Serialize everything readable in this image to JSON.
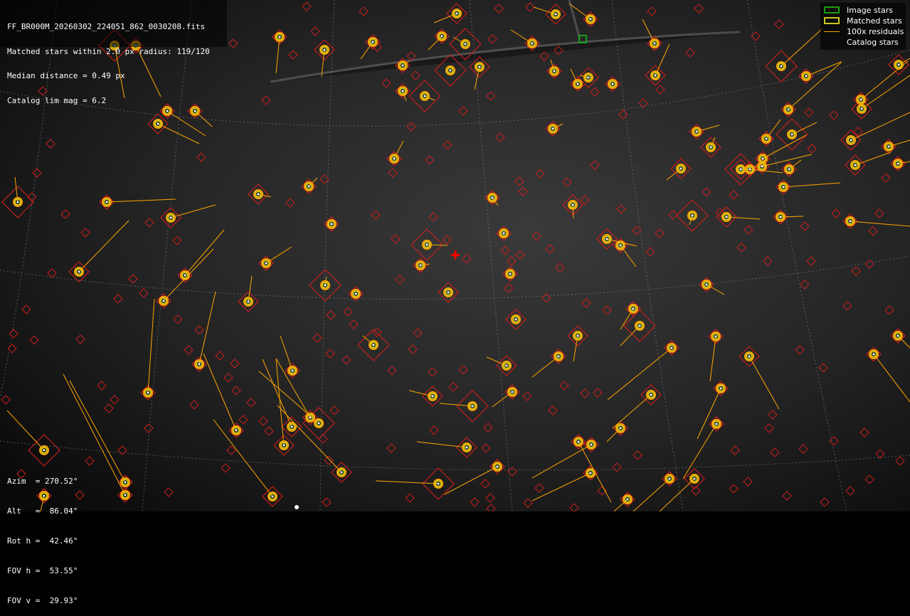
{
  "info": {
    "filename": "FF_BR000M_20260302_224051_862_0030208.fits",
    "matched": "Matched stars within 2.0 px radius: 119/120",
    "median": "Median distance = 0.49 px",
    "limmag": "Catalog lim mag = 6.2"
  },
  "legend": {
    "image_stars": "Image stars",
    "matched_stars": "Matched stars",
    "residuals": "100x residuals",
    "catalog_stars": "Catalog stars"
  },
  "pose": {
    "azim": "Azim  = 270.52°",
    "alt": "Alt   =  86.04°",
    "rot": "Rot h =  42.46°",
    "fovh": "FOV h =  53.55°",
    "fovv": "FOV v =  29.93°"
  },
  "colors": {
    "image_star": "#14a014",
    "matched_star": "#c8c81e",
    "residual": "#ffa500",
    "catalog_star": "#c81e1e",
    "center_marker": "#ff0000"
  }
}
